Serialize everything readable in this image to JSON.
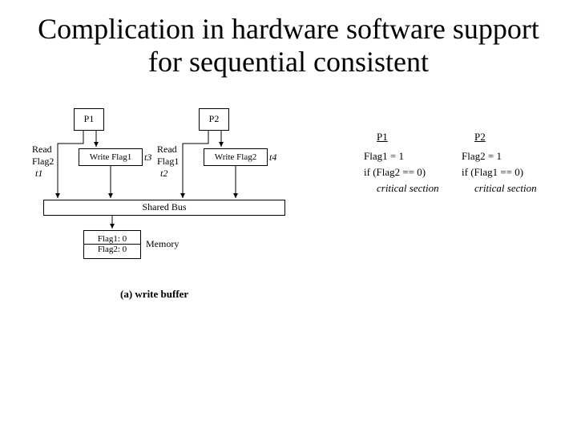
{
  "title": "Complication in hardware software support for sequential consistent",
  "diagram": {
    "p1": "P1",
    "p2": "P2",
    "read1_a": "Read",
    "read1_b": "Flag2",
    "t1": "t1",
    "read2_a": "Read",
    "read2_b": "Flag1",
    "t2": "t2",
    "wbuf1": "Write Flag1",
    "t3": "t3",
    "wbuf2": "Write Flag2",
    "t4": "t4",
    "bus": "Shared Bus",
    "mem": "Memory",
    "flag1": "Flag1: 0",
    "flag2": "Flag2: 0",
    "caption": "(a) write buffer"
  },
  "code": {
    "p1h": "P1",
    "p2h": "P2",
    "p1l1": "Flag1 = 1",
    "p1l2": "if (Flag2 == 0)",
    "p1l3": "critical section",
    "p2l1": "Flag2 = 1",
    "p2l2": "if (Flag1 == 0)",
    "p2l3": "critical section"
  }
}
